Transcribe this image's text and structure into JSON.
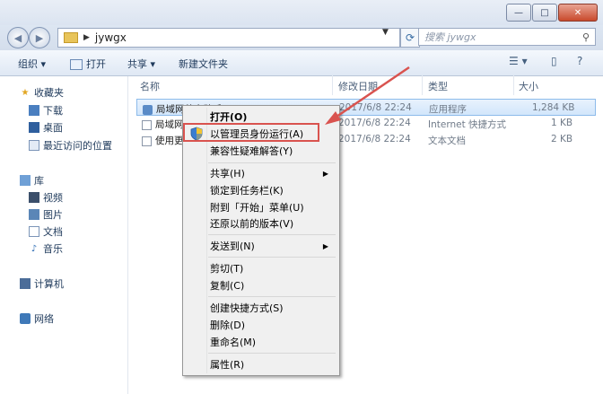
{
  "window": {
    "caption_buttons": {
      "minimize": "—",
      "maximize": "□",
      "close": "✕"
    }
  },
  "address": {
    "path": "jywgx",
    "search_placeholder": "搜索 jywgx"
  },
  "toolbar": {
    "organize": "组织 ▾",
    "open": "打开",
    "share": "共享 ▾",
    "new_folder": "新建文件夹"
  },
  "nav": {
    "favorites": "收藏夹",
    "downloads": "下载",
    "desktop": "桌面",
    "recent": "最近访问的位置",
    "library": "库",
    "videos": "视频",
    "pictures": "图片",
    "documents": "文档",
    "music": "音乐",
    "computer": "计算机",
    "network": "网络"
  },
  "columns": {
    "name": "名称",
    "modified": "修改日期",
    "type": "类型",
    "size": "大小"
  },
  "files": [
    {
      "name": "局域网共享助手",
      "modified": "2017/6/8 22:24",
      "type": "应用程序",
      "size": "1,284 KB",
      "selected": true
    },
    {
      "name": "局域网",
      "modified": "2017/6/8 22:24",
      "type": "Internet 快捷方式",
      "size": "1 KB",
      "selected": false
    },
    {
      "name": "使用更",
      "modified": "2017/6/8 22:24",
      "type": "文本文档",
      "size": "2 KB",
      "selected": false
    }
  ],
  "context_menu": {
    "open": "打开(O)",
    "run_as_admin": "以管理员身份运行(A)",
    "troubleshoot": "兼容性疑难解答(Y)",
    "share": "共享(H)",
    "pin_taskbar": "锁定到任务栏(K)",
    "pin_start": "附到「开始」菜单(U)",
    "restore": "还原以前的版本(V)",
    "send_to": "发送到(N)",
    "cut": "剪切(T)",
    "copy": "复制(C)",
    "create_shortcut": "创建快捷方式(S)",
    "delete": "删除(D)",
    "rename": "重命名(M)",
    "properties": "属性(R)"
  },
  "colors": {
    "highlight_box": "#d9534f",
    "selection": "#d2e6fb"
  }
}
